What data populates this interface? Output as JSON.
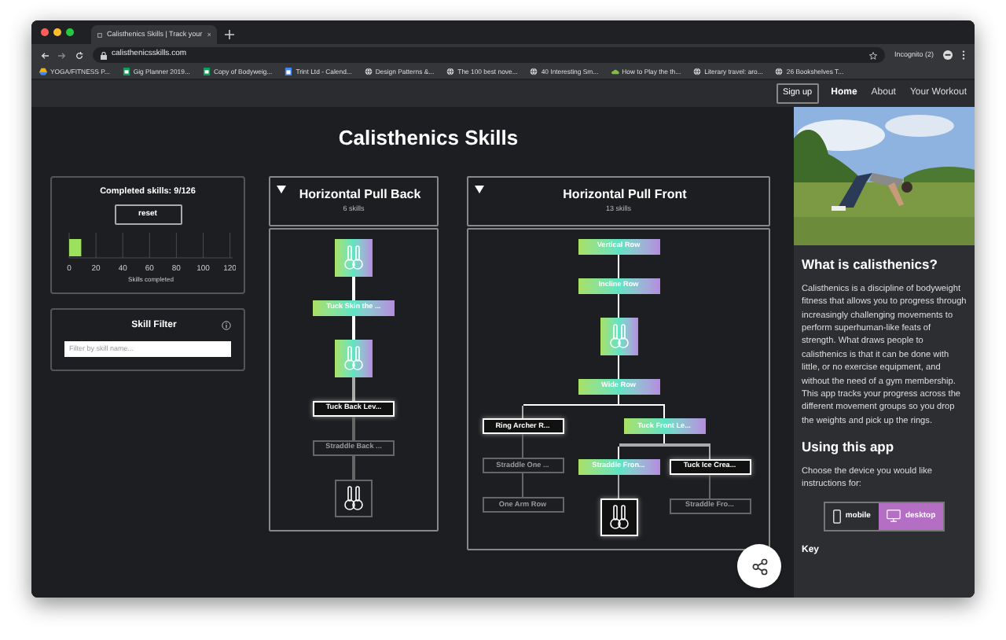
{
  "browser": {
    "tab_title": "Calisthenics Skills | Track your",
    "url": "calisthenicsskills.com",
    "profile": "Incognito (2)",
    "bookmarks": [
      {
        "label": "YOGA/FITNESS P...",
        "kind": "drive"
      },
      {
        "label": "Gig Planner 2019...",
        "kind": "sheet"
      },
      {
        "label": "Copy of Bodyweig...",
        "kind": "sheet"
      },
      {
        "label": "Trint Ltd - Calend...",
        "kind": "calendar"
      },
      {
        "label": "Design Patterns &...",
        "kind": "globe"
      },
      {
        "label": "The 100 best nove...",
        "kind": "globe"
      },
      {
        "label": "40 Interesting Sm...",
        "kind": "globe"
      },
      {
        "label": "How to Play the th...",
        "kind": "cloud"
      },
      {
        "label": "Literary travel: aro...",
        "kind": "globe"
      },
      {
        "label": "26 Bookshelves T...",
        "kind": "globe"
      }
    ]
  },
  "nav": {
    "sign_up": "Sign up",
    "links": [
      {
        "label": "Home",
        "selected": true
      },
      {
        "label": "About",
        "selected": false
      },
      {
        "label": "Your Workout",
        "selected": false
      }
    ]
  },
  "page_title": "Calisthenics Skills",
  "progress": {
    "title": "Completed skills: 9/126",
    "reset": "reset",
    "meter": {
      "level": 0.074,
      "scale": [
        "0",
        "20",
        "40",
        "60",
        "80",
        "100",
        "120"
      ],
      "caption": "Skills completed"
    }
  },
  "filter": {
    "title": "Skill Filter",
    "placeholder": "Filter by skill name..."
  },
  "trees": [
    {
      "title": "Horizontal Pull Back",
      "count": "6 skills",
      "expanded": true,
      "root": {
        "kind": "icon",
        "completed": true,
        "children": [
          {
            "kind": "label",
            "label": "Tuck Skin the ...",
            "completed": true,
            "children": [
              {
                "kind": "icon",
                "completed": true,
                "children": [
                  {
                    "kind": "label",
                    "label": "Tuck Back Lev...",
                    "completed": false,
                    "unlocked": true,
                    "children": [
                      {
                        "kind": "label",
                        "label": "Straddle Back ...",
                        "completed": false,
                        "unlocked": false,
                        "children": [
                          {
                            "kind": "icon",
                            "completed": false,
                            "unlocked": false
                          }
                        ]
                      }
                    ]
                  }
                ]
              }
            ]
          }
        ]
      }
    },
    {
      "title": "Horizontal Pull Front",
      "count": "13 skills",
      "expanded": true,
      "root": {
        "kind": "label",
        "label": "Vertical Row",
        "completed": true,
        "children": [
          {
            "kind": "label",
            "label": "Incline Row",
            "completed": true,
            "children": [
              {
                "kind": "icon",
                "completed": true,
                "children": [
                  {
                    "kind": "label",
                    "label": "Wide Row",
                    "completed": true,
                    "children": [
                      {
                        "kind": "label",
                        "label": "Ring Archer R...",
                        "completed": false,
                        "unlocked": true,
                        "children": [
                          {
                            "kind": "label",
                            "label": "Straddle One ...",
                            "completed": false,
                            "unlocked": false,
                            "children": [
                              {
                                "kind": "label",
                                "label": "One Arm Row",
                                "completed": false,
                                "unlocked": false
                              }
                            ]
                          }
                        ]
                      },
                      {
                        "kind": "label",
                        "label": "Tuck Front Le...",
                        "completed": true,
                        "children": [
                          {
                            "kind": "label",
                            "label": "Straddle Fron...",
                            "completed": true,
                            "children": [
                              {
                                "kind": "icon",
                                "completed": false,
                                "unlocked": true
                              }
                            ]
                          },
                          {
                            "kind": "label",
                            "label": "Tuck Ice Crea...",
                            "completed": false,
                            "unlocked": true,
                            "children": [
                              {
                                "kind": "label",
                                "label": "Straddle Fro...",
                                "completed": false,
                                "unlocked": false
                              }
                            ]
                          }
                        ]
                      }
                    ]
                  }
                ]
              }
            ]
          }
        ]
      }
    }
  ],
  "sidebar": {
    "heading": "What is calisthenics?",
    "body": "Calisthenics is a discipline of bodyweight fitness that allows you to progress through increasingly challenging movements to perform superhuman-like feats of strength. What draws people to calisthenics is that it can be done with little, or no exercise equipment, and without the need of a gym membership. This app tracks your progress across the different movement groups so you drop the weights and pick up the rings.",
    "heading_2": "Using this app",
    "prompt": "Choose the device you would like instructions for:",
    "devices": [
      {
        "label": "mobile",
        "kind": "phone",
        "selected": false
      },
      {
        "label": "desktop",
        "kind": "monitor",
        "selected": true
      }
    ],
    "key_heading": "Key"
  }
}
